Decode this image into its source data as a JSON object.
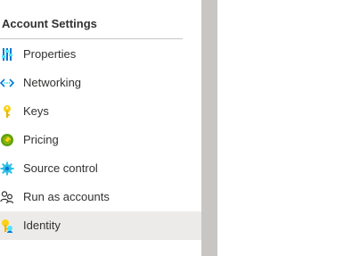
{
  "sidebar": {
    "section_title": "Account Settings",
    "items": [
      {
        "label": "Properties",
        "icon": "properties-icon",
        "selected": false
      },
      {
        "label": "Networking",
        "icon": "networking-icon",
        "selected": false
      },
      {
        "label": "Keys",
        "icon": "key-icon",
        "selected": false
      },
      {
        "label": "Pricing",
        "icon": "pricing-icon",
        "selected": false
      },
      {
        "label": "Source control",
        "icon": "source-control-icon",
        "selected": false
      },
      {
        "label": "Run as accounts",
        "icon": "run-as-accounts-icon",
        "selected": false
      },
      {
        "label": "Identity",
        "icon": "identity-icon",
        "selected": true
      }
    ]
  },
  "colors": {
    "text": "#323130",
    "divider": "#c8c6c4",
    "selected_background": "#edebe9",
    "splitter": "#c8c6c4",
    "accent_blue": "#0078d4",
    "key_yellow": "#fcd116",
    "pricing_green": "#5ea40a",
    "gear_cyan": "#32bfe6"
  }
}
